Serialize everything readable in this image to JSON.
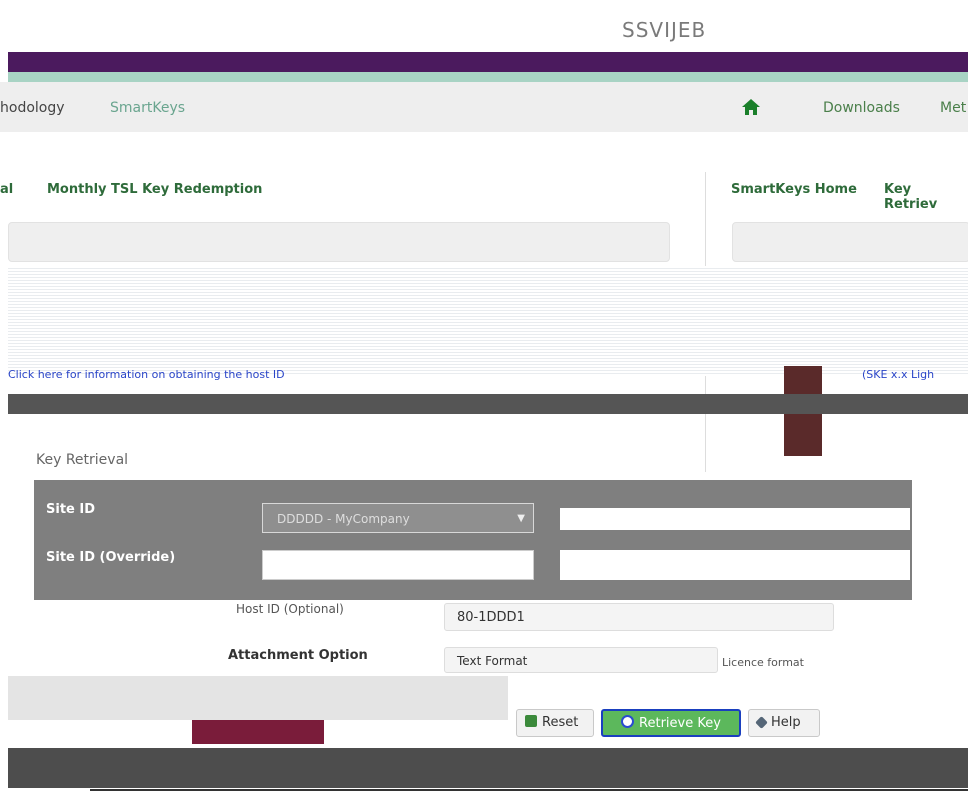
{
  "header": {
    "logo_text": "SSVIJEB"
  },
  "nav": {
    "items": [
      {
        "label": "hodology",
        "color": "#444444"
      },
      {
        "label": "SmartKeys",
        "color": "#6aa58f"
      }
    ],
    "right_items": [
      {
        "label": "Downloads",
        "color": "#4a7f4a"
      },
      {
        "label": "Met",
        "color": "#4a7f4a"
      }
    ],
    "accent": "#1a7f2a",
    "home_icon": "home-icon"
  },
  "tabs": {
    "left": [
      "al",
      "Monthly TSL Key Redemption"
    ],
    "right": [
      "SmartKeys Home",
      "Key Retriev"
    ]
  },
  "info": {
    "link_text": "Click here for information on obtaining the host ID",
    "right_text": "(SKE x.x Ligh"
  },
  "form": {
    "legend": "Key Retrieval",
    "site_id_label": "Site ID",
    "site_id_value": "DDDDD - MyCompany",
    "site_override_label": "Site ID (Override)",
    "host_id_label": "Host ID (Optional)",
    "host_id_value": "80-1DDD1",
    "attachment_label": "Attachment Option",
    "attachment_value": "Text Format",
    "attachment_right": "Licence format"
  },
  "buttons": {
    "reset": "Reset",
    "retrieve": "Retrieve Key",
    "help": "Help"
  }
}
